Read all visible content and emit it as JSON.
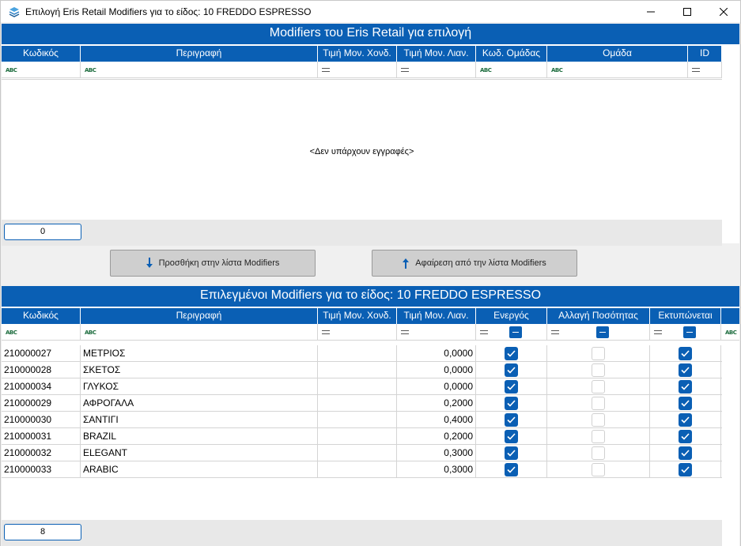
{
  "window": {
    "title": "Επιλογή Eris Retail Modifiers για το είδος: 10  FREDDO ESPRESSO"
  },
  "top_panel": {
    "header": "Modifiers του Eris Retail για επιλογή",
    "columns": [
      "Κωδικός",
      "Περιγραφή",
      "Τιμή Μον. Χονδ.",
      "Τιμή Μον. Λιαν.",
      "Κωδ. Ομάδας",
      "Ομάδα",
      "ID"
    ],
    "filter_icons": [
      "abc-icon",
      "abc-icon",
      "equals-icon",
      "equals-icon",
      "abc-icon",
      "abc-icon",
      "equals-icon"
    ],
    "abc_label": "ABC",
    "empty_message": "<Δεν υπάρχουν εγγραφές>",
    "count": "0"
  },
  "buttons": {
    "add_label": "Προσθήκη στην λίστα Modifiers",
    "remove_label": "Αφαίρεση από την λίστα Modifiers"
  },
  "bottom_panel": {
    "header": "Επιλεγμένοι Modifiers για το είδος: 10  FREDDO ESPRESSO",
    "columns": [
      "Κωδικός",
      "Περιγραφή",
      "Τιμή Μον. Χονδ.",
      "Τιμή Μον. Λιαν.",
      "Ενεργός",
      "Αλλαγή Ποσότητας",
      "Εκτυπώνεται",
      ""
    ],
    "rows": [
      {
        "code": "210000027",
        "desc": "ΜΕΤΡΙΟΣ",
        "wholesale": "",
        "retail": "0,0000",
        "active": true,
        "qty_change": false,
        "printed": true
      },
      {
        "code": "210000028",
        "desc": "ΣΚΕΤΟΣ",
        "wholesale": "",
        "retail": "0,0000",
        "active": true,
        "qty_change": false,
        "printed": true
      },
      {
        "code": "210000034",
        "desc": "ΓΛΥΚΟΣ",
        "wholesale": "",
        "retail": "0,0000",
        "active": true,
        "qty_change": false,
        "printed": true
      },
      {
        "code": "210000029",
        "desc": "ΑΦΡΟΓΑΛΑ",
        "wholesale": "",
        "retail": "0,2000",
        "active": true,
        "qty_change": false,
        "printed": true
      },
      {
        "code": "210000030",
        "desc": "ΣΑΝΤΙΓΙ",
        "wholesale": "",
        "retail": "0,4000",
        "active": true,
        "qty_change": false,
        "printed": true
      },
      {
        "code": "210000031",
        "desc": "BRAZIL",
        "wholesale": "",
        "retail": "0,2000",
        "active": true,
        "qty_change": false,
        "printed": true
      },
      {
        "code": "210000032",
        "desc": "ELEGANT",
        "wholesale": "",
        "retail": "0,3000",
        "active": true,
        "qty_change": false,
        "printed": true
      },
      {
        "code": "210000033",
        "desc": "ARABIC",
        "wholesale": "",
        "retail": "0,3000",
        "active": true,
        "qty_change": false,
        "printed": true
      }
    ],
    "count": "8"
  },
  "colors": {
    "header_blue": "#0a5fb4",
    "checkbox_on": "#0a5fb4"
  }
}
